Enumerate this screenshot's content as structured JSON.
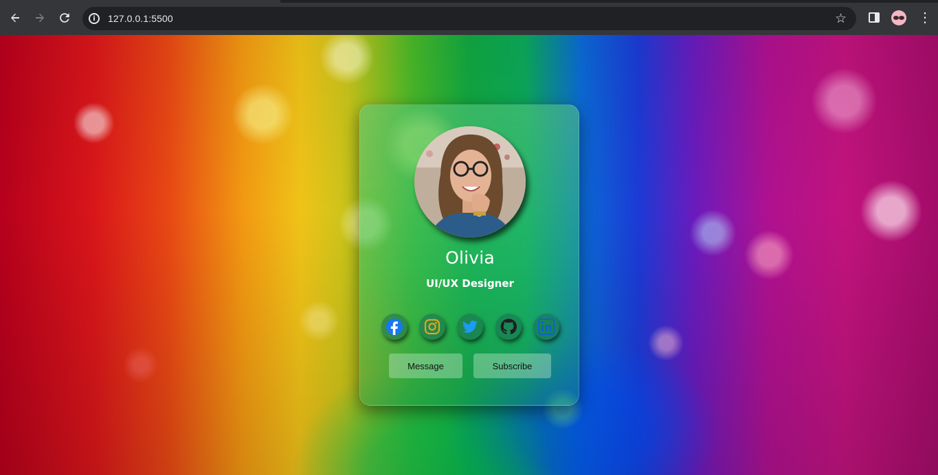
{
  "browser": {
    "url": "127.0.0.1:5500",
    "icons": {
      "back": "arrow-left-icon",
      "forward": "arrow-right-icon",
      "reload": "reload-icon",
      "site_info": "info-icon",
      "bookmark": "star-icon",
      "side_panel": "side-panel-icon",
      "profile": "profile-avatar",
      "menu": "kebab-menu-icon"
    }
  },
  "profile_card": {
    "name": "Olivia",
    "role": "UI/UX Designer",
    "socials": [
      {
        "network": "facebook",
        "color": "#1877f2"
      },
      {
        "network": "instagram",
        "color": "#e1a623"
      },
      {
        "network": "twitter",
        "color": "#1d9bf0"
      },
      {
        "network": "github",
        "color": "#1b1f23"
      },
      {
        "network": "linkedin",
        "color": "#0a66c2"
      }
    ],
    "buttons": {
      "message": "Message",
      "subscribe": "Subscribe"
    }
  }
}
